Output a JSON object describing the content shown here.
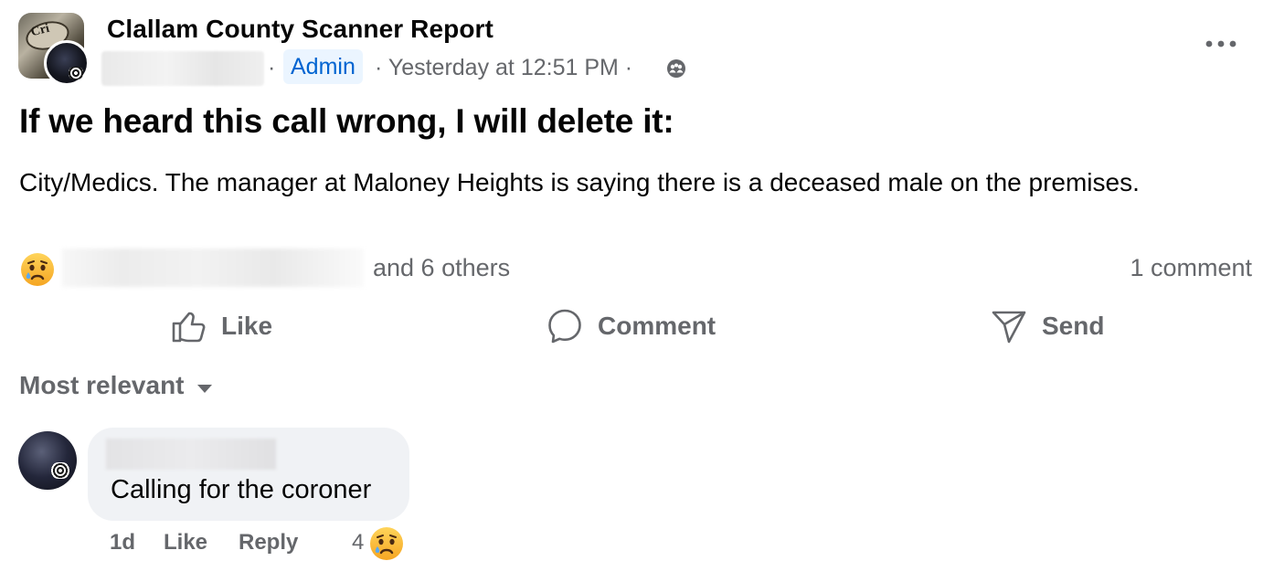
{
  "post": {
    "group_name": "Clallam County Scanner Report",
    "badge_text": "Cri",
    "role_badge": "Admin",
    "separator": "·",
    "timestamp": "· Yesterday at 12:51 PM ·",
    "title": "If we heard this call wrong, I will delete it:",
    "body": "City/Medics. The manager at Maloney Heights is saying there is a deceased male on the premises."
  },
  "reactions": {
    "emoji": "crying-face",
    "others_text": "and 6 others",
    "comment_count": "1 comment"
  },
  "actions": {
    "like": "Like",
    "comment": "Comment",
    "send": "Send"
  },
  "comments": {
    "sort_label": "Most relevant",
    "items": [
      {
        "text": "Calling for the coroner",
        "time": "1d",
        "like": "Like",
        "reply": "Reply",
        "reaction_count": "4"
      }
    ]
  },
  "colors": {
    "text": "#050505",
    "secondary": "#65676b",
    "admin_bg": "#ebf5ff",
    "admin_text": "#0064d1",
    "bubble_bg": "#f0f2f5"
  }
}
